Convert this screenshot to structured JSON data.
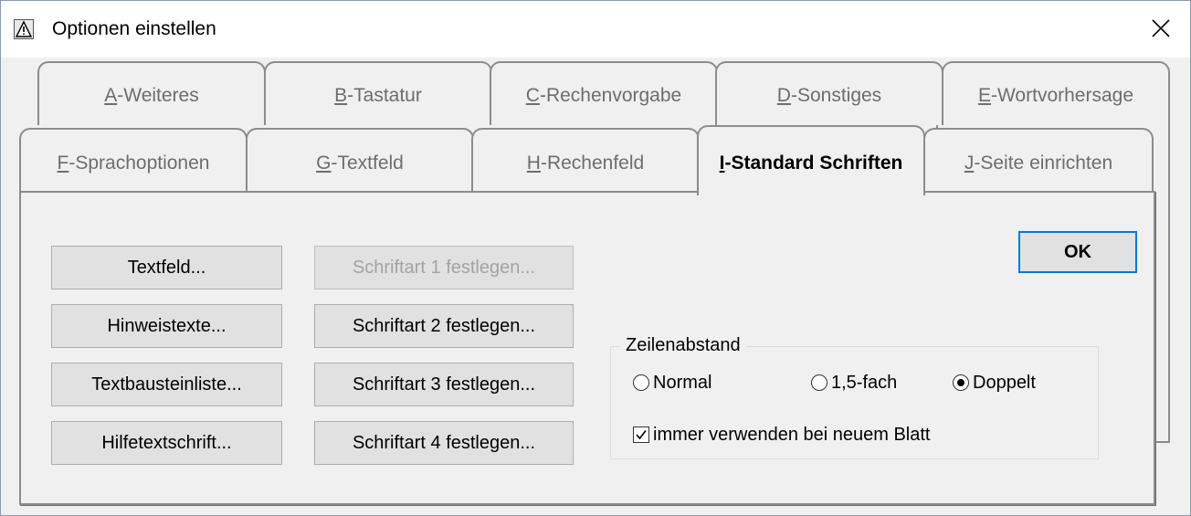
{
  "window": {
    "title": "Optionen einstellen",
    "icon": "warning-icon",
    "close_symbol": "✕"
  },
  "tabs": {
    "row1": [
      {
        "key": "A",
        "rest": "-Weiteres"
      },
      {
        "key": "B",
        "rest": "-Tastatur"
      },
      {
        "key": "C",
        "rest": "-Rechenvorgabe"
      },
      {
        "key": "D",
        "rest": "-Sonstiges"
      },
      {
        "key": "E",
        "rest": "-Wortvorhersage"
      }
    ],
    "row2": [
      {
        "key": "F",
        "rest": "-Sprachoptionen"
      },
      {
        "key": "G",
        "rest": "-Textfeld"
      },
      {
        "key": "H",
        "rest": "-Rechenfeld"
      },
      {
        "key": "I",
        "rest": "-Standard Schriften"
      },
      {
        "key": "J",
        "rest": "-Seite einrichten"
      }
    ],
    "active": "I-Standard Schriften"
  },
  "buttons": {
    "textfeld": "Textfeld...",
    "hinweistexte": "Hinweistexte...",
    "textbausteinliste": "Textbausteinliste...",
    "hilfetextschrift": "Hilfetextschrift...",
    "schriftart1": "Schriftart 1 festlegen...",
    "schriftart2": "Schriftart 2 festlegen...",
    "schriftart3": "Schriftart 3 festlegen...",
    "schriftart4": "Schriftart 4 festlegen...",
    "ok": "OK"
  },
  "zeilenabstand": {
    "label": "Zeilenabstand",
    "options": [
      "Normal",
      "1,5-fach",
      "Doppelt"
    ],
    "selected": "Doppelt",
    "checkbox_label": "immer verwenden bei neuem Blatt",
    "checkbox_checked": true
  }
}
